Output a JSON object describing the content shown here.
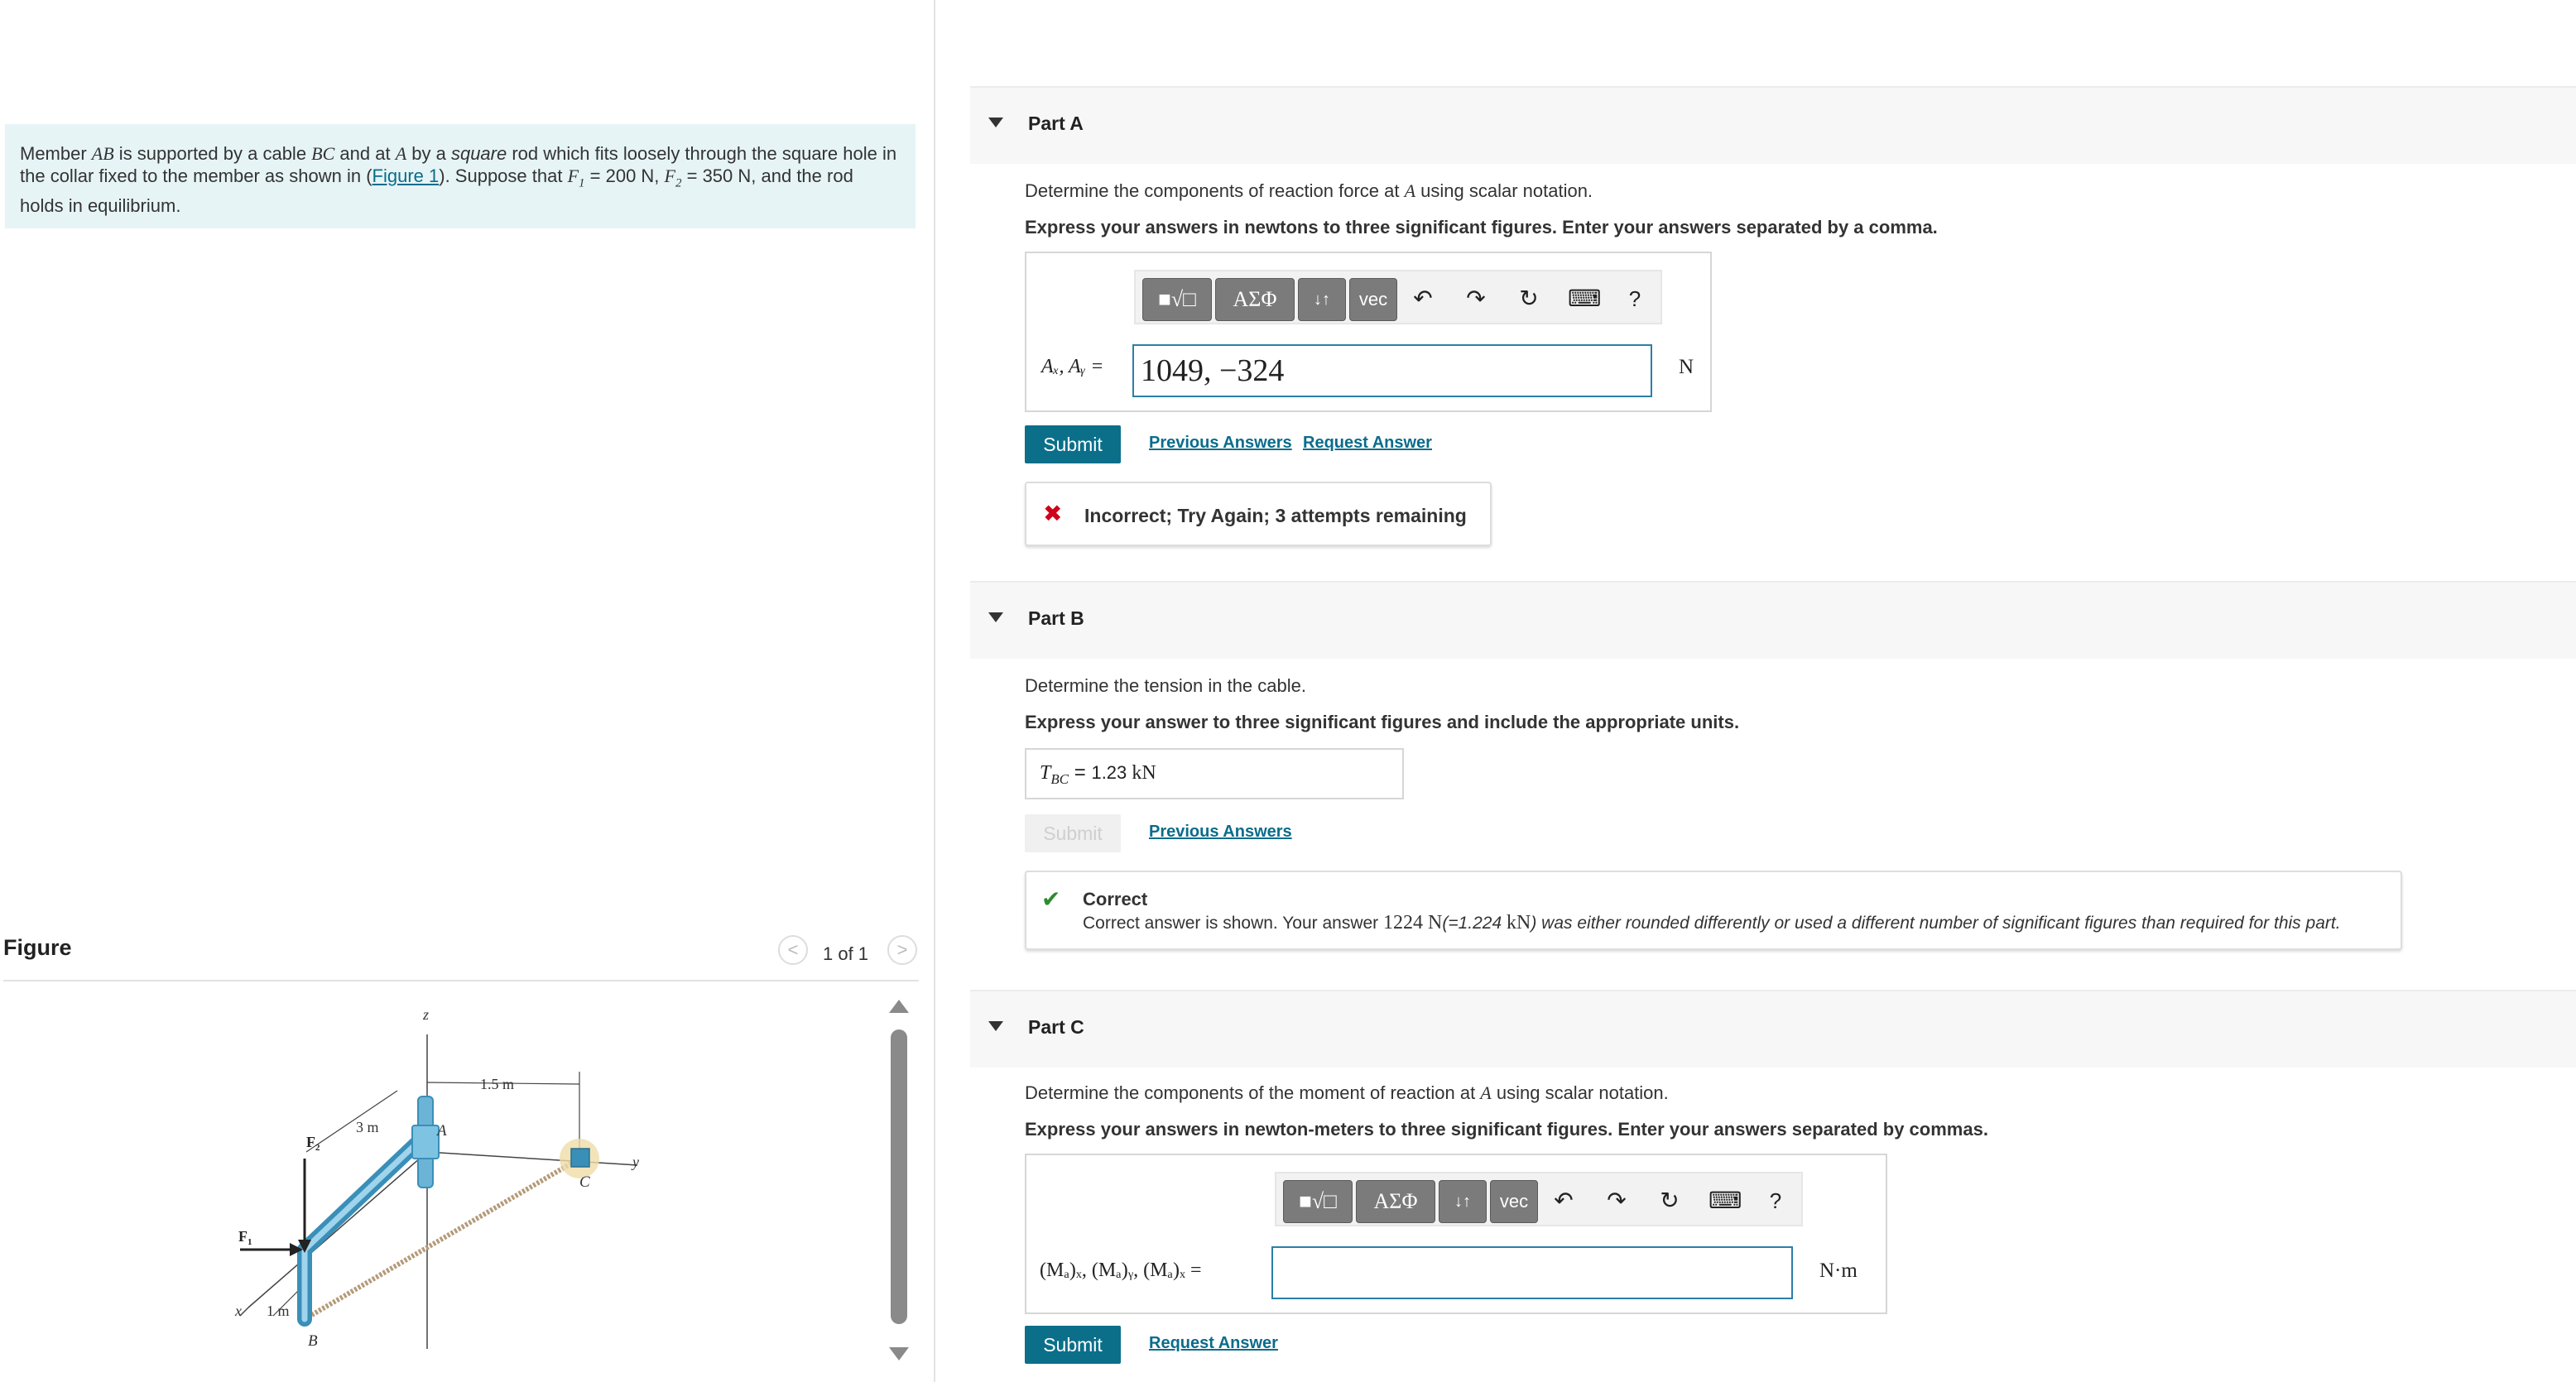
{
  "problem": {
    "text_1": "Member ",
    "var_AB": "AB",
    "text_2": " is supported by a cable ",
    "var_BC": "BC",
    "text_3": " and at ",
    "var_A": "A",
    "text_4": " by a ",
    "emph": "square",
    "text_5": " rod which fits loosely through the square hole in the collar fixed to the member as shown in (",
    "figure_link": "Figure 1",
    "text_6": "). Suppose that ",
    "f1_sym": "F",
    "f1_sub": "1",
    "f1_val": " = 200 N, ",
    "f2_sym": "F",
    "f2_sub": "2",
    "f2_val": " = 350 N",
    "text_7": ", and the rod holds in equilibrium."
  },
  "figure": {
    "title": "Figure",
    "pager": "1 of 1",
    "prev": "<",
    "next": ">",
    "labels": {
      "z": "z",
      "y": "y",
      "x": "x",
      "A": "A",
      "B": "B",
      "C": "C",
      "F1": "F",
      "F1_sub": "1",
      "F2": "F",
      "F2_sub": "2",
      "dim_3m": "3 m",
      "dim_15m": "1.5 m",
      "dim_1m": "1 m"
    }
  },
  "toolbar": {
    "templates": "■√□",
    "greek": "AΣΦ",
    "arrows": "↓↑",
    "vec": "vec",
    "undo": "↶",
    "redo": "↷",
    "reset": "↻",
    "keyboard": "⌨",
    "help": "?"
  },
  "partA": {
    "label": "Part A",
    "question_pre": "Determine the components of reaction force at ",
    "question_var": "A",
    "question_post": " using scalar notation.",
    "instruction": "Express your answers in newtons to three significant figures. Enter your answers separated by a comma.",
    "lhs": "Aₓ, Aᵧ =",
    "value": "1049, −324",
    "unit": "N",
    "submit": "Submit",
    "previous_answers": "Previous Answers",
    "request_answer": "Request Answer",
    "feedback": "Incorrect; Try Again; 3 attempts remaining",
    "feedback_icon": "✖"
  },
  "partB": {
    "label": "Part B",
    "question": "Determine the tension in the cable.",
    "instruction": "Express your answer to three significant figures and include the appropriate units.",
    "lhs": "T",
    "lhs_sub": "BC",
    "eq": " = ",
    "value": "1.23 ",
    "value_unit": "kN",
    "submit": "Submit",
    "previous_answers": "Previous Answers",
    "feedback_icon": "✔",
    "feedback_title": "Correct",
    "feedback_pre": "Correct answer is shown. Your answer ",
    "feedback_ans": "1224 N",
    "feedback_mid": "(=1.224 ",
    "feedback_unit": "kN",
    "feedback_post": ") was either rounded differently or used a different number of significant figures than required for this part."
  },
  "partC": {
    "label": "Part C",
    "question_pre": "Determine the components of the moment of reaction at ",
    "question_var": "A",
    "question_post": " using scalar notation.",
    "instruction": "Express your answers in newton-meters to three significant figures. Enter your answers separated by commas.",
    "lhs": "(Mₐ)ₓ, (Mₐ)ᵧ, (Mₐ)ₓ =",
    "value": "",
    "unit": "N·m",
    "submit": "Submit",
    "request_answer": "Request Answer"
  },
  "colors": {
    "accent": "#0b6f8a",
    "problem_bg": "#e6f4f6",
    "incorrect": "#d0021b",
    "correct": "#2e8b2e"
  }
}
